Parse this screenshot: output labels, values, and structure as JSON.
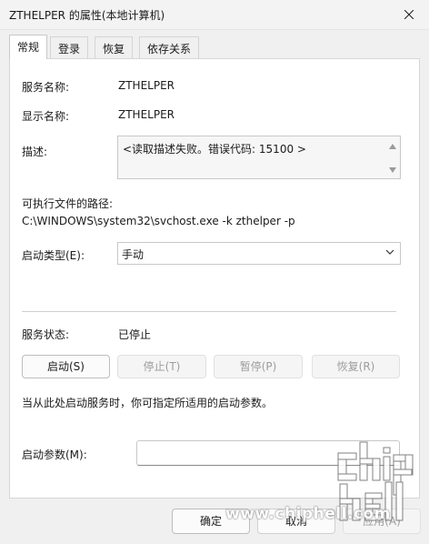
{
  "window": {
    "title": "ZTHELPER 的属性(本地计算机)"
  },
  "tabs": [
    {
      "label": "常规",
      "active": true
    },
    {
      "label": "登录",
      "active": false
    },
    {
      "label": "恢复",
      "active": false
    },
    {
      "label": "依存关系",
      "active": false
    }
  ],
  "general": {
    "service_name_label": "服务名称:",
    "service_name_value": "ZTHELPER",
    "display_name_label": "显示名称:",
    "display_name_value": "ZTHELPER",
    "description_label": "描述:",
    "description_value": "<读取描述失败。错误代码: 15100 >",
    "exe_path_label": "可执行文件的路径:",
    "exe_path_value": "C:\\WINDOWS\\system32\\svchost.exe -k zthelper -p",
    "startup_type_label": "启动类型(E):",
    "startup_type_value": "手动",
    "service_status_label": "服务状态:",
    "service_status_value": "已停止",
    "buttons": {
      "start": "启动(S)",
      "stop": "停止(T)",
      "pause": "暂停(P)",
      "resume": "恢复(R)"
    },
    "hint": "当从此处启动服务时，你可指定所适用的启动参数。",
    "start_params_label": "启动参数(M):",
    "start_params_value": ""
  },
  "footer": {
    "ok": "确定",
    "cancel": "取消",
    "apply": "应用(A)"
  },
  "watermark": {
    "logo_text": "chip hell",
    "url": "www.chiphell.com"
  }
}
